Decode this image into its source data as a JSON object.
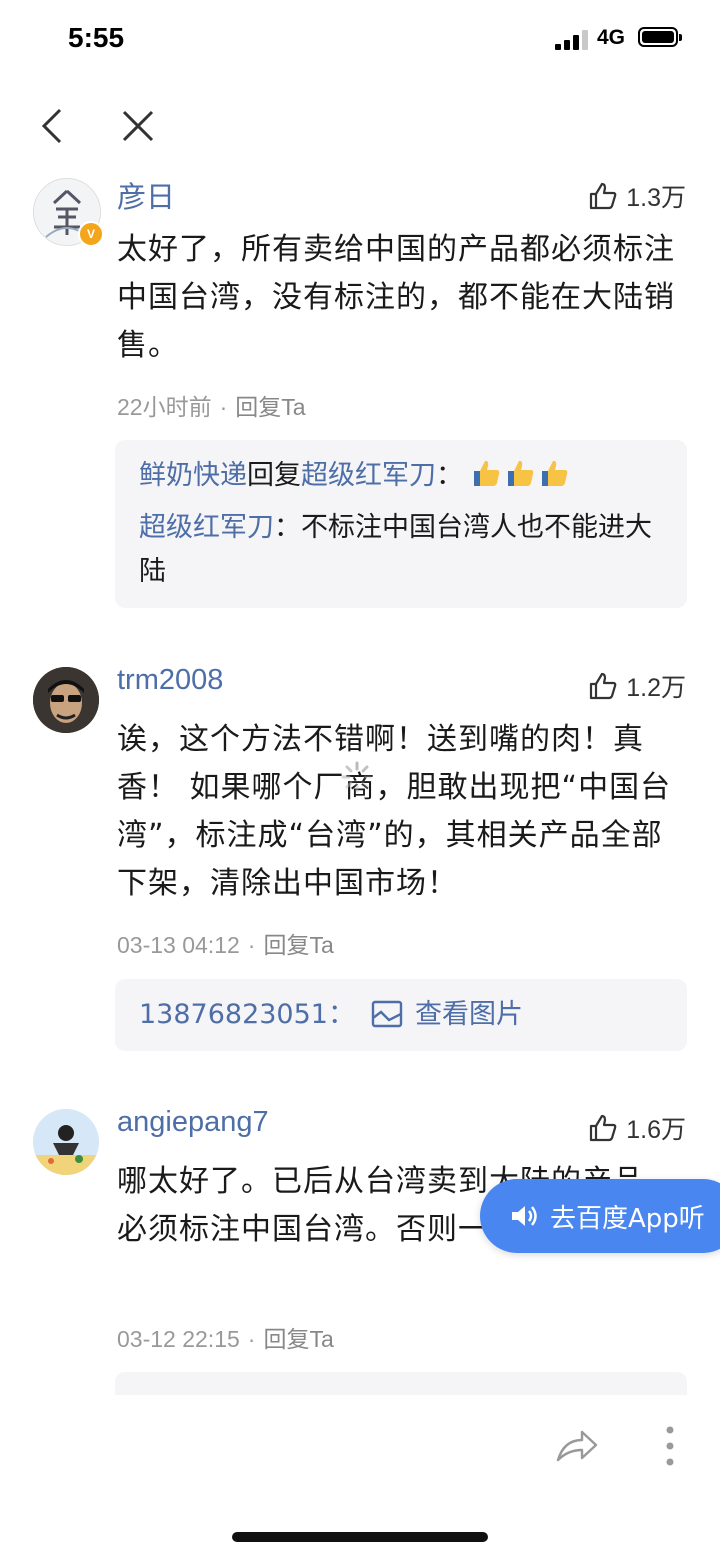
{
  "status_bar": {
    "time": "5:55",
    "network": "4G"
  },
  "comments": [
    {
      "username": "彦日",
      "likes": "1.3万",
      "text": "太好了，所有卖给中国的产品都必须标注中国台湾，没有标注的，都不能在大陆销售。",
      "time": "22小时前",
      "reply_label": "回复Ta",
      "replies": [
        {
          "from": "鲜奶快递",
          "verb": "回复",
          "to": "超级红军刀",
          "sep": "："
        },
        {
          "from": "超级红军刀",
          "sep": "：",
          "text": "不标注中国台湾人也不能进大陆"
        }
      ]
    },
    {
      "username": "trm2008",
      "likes": "1.2万",
      "text": "诶，这个方法不错啊！送到嘴的肉！真香！ 如果哪个厂商，胆敢出现把“中国台湾”，标注成“台湾”的，其相关产品全部下架，清除出中国市场！",
      "time": "03-13 04:12",
      "reply_label": "回复Ta",
      "replies": [
        {
          "from": "13876823051",
          "sep": "：",
          "link": "查看图片"
        }
      ]
    },
    {
      "username": "angiepang7",
      "likes": "1.6万",
      "text": "哪太好了。已后从台湾卖到大陆的产品。必须标注中国台湾。否则一律不许卖。",
      "time": "03-12 22:15",
      "reply_label": "回复Ta"
    }
  ],
  "floating_button": {
    "label": "去百度App听"
  },
  "icons": {
    "back": "chevron-left-icon",
    "close": "close-icon",
    "like": "thumbs-up-icon",
    "share": "share-arrow-icon",
    "more": "more-vertical-icon",
    "image": "image-icon",
    "speaker": "speaker-icon"
  },
  "colors": {
    "username": "#4e6ea8",
    "accent": "#4a86f0",
    "reply_bg": "#f5f5f7",
    "badge": "#f3a51c"
  }
}
